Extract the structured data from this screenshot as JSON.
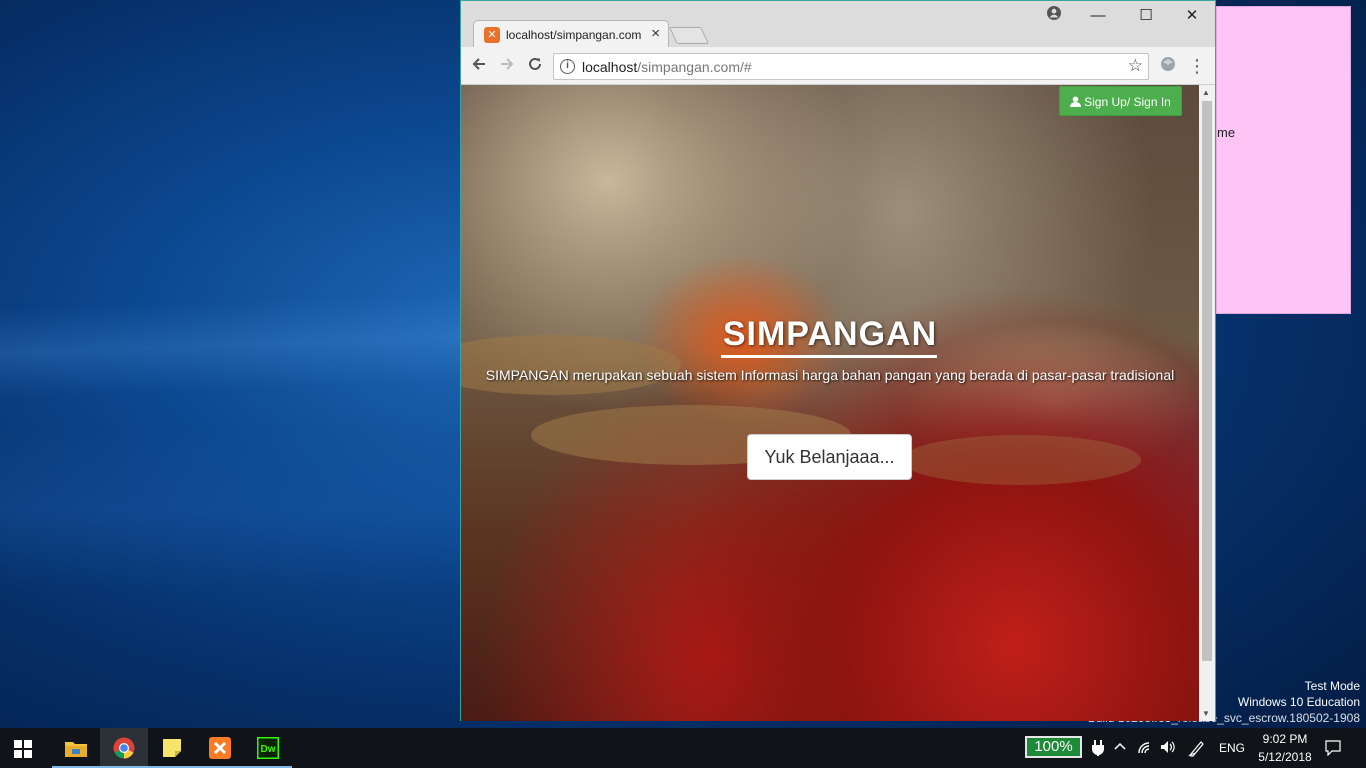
{
  "desktop": {
    "sticky_note_text": "me",
    "watermark": {
      "line1": "Test Mode",
      "line2": "Windows 10 Education",
      "line3": "Build 10255.rs3_release_svc_escrow.180502-1908"
    }
  },
  "browser": {
    "tab": {
      "title": "localhost/simpangan.com",
      "close": "×",
      "favicon": "xampp-icon"
    },
    "window_controls": {
      "account": "account-icon",
      "minimize": "—",
      "maximize": "☐",
      "close": "✕"
    },
    "toolbar": {
      "back": "back-arrow-icon",
      "forward": "forward-arrow-icon",
      "reload": "reload-icon",
      "url_host": "localhost",
      "url_path": "/simpangan.com/#",
      "star": "☆",
      "menu": "⋮"
    }
  },
  "page": {
    "signin_label": "Sign Up/ Sign In",
    "title": "SIMPANGAN",
    "subtitle": "SIMPANGAN merupakan sebuah sistem Informasi harga bahan pangan yang berada di pasar-pasar tradisional",
    "cta_label": "Yuk Belanjaaa..."
  },
  "taskbar": {
    "apps": [
      "file-explorer-icon",
      "chrome-icon",
      "sticky-notes-icon",
      "xampp-icon",
      "dreamweaver-icon"
    ],
    "zoom": "100%",
    "language": "ENG",
    "time": "9:02 PM",
    "date": "5/12/2018"
  },
  "colors": {
    "signin_green": "#4cae4c",
    "sticky_pink": "#fcc5f5",
    "zoom_green": "#1c8a38"
  }
}
